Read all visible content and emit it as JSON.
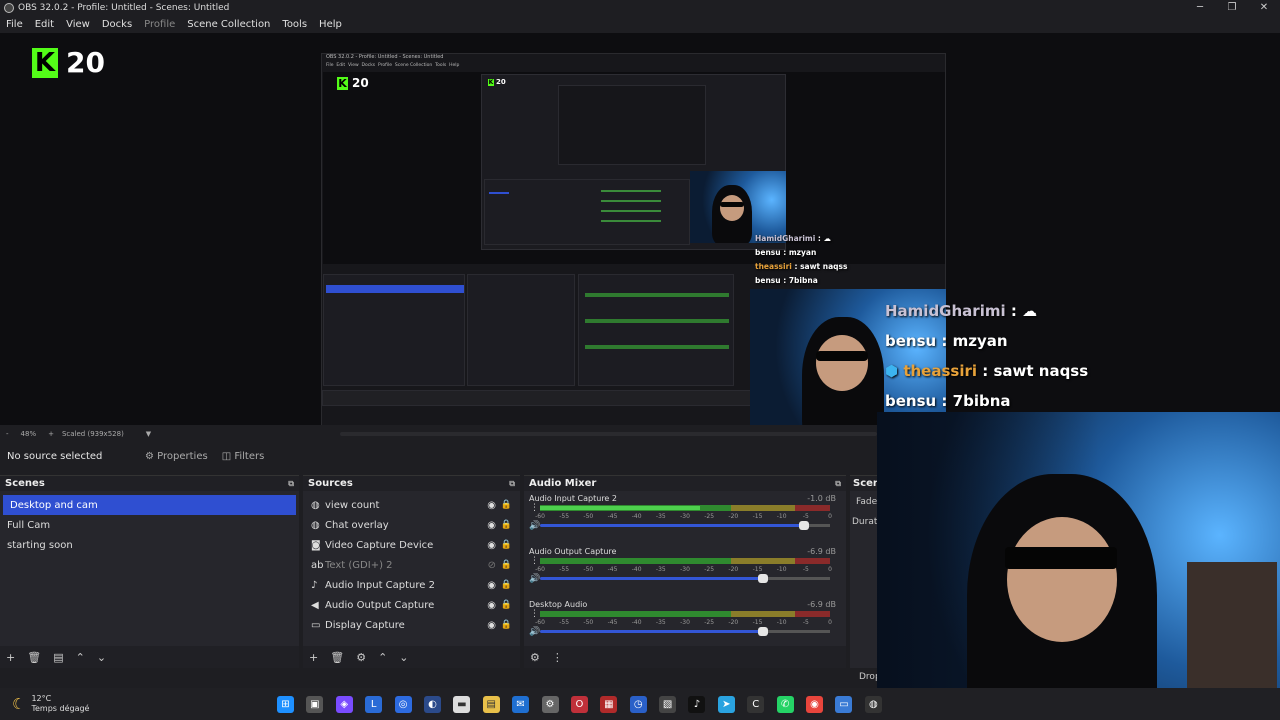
{
  "window": {
    "title": "OBS 32.0.2 - Profile: Untitled - Scenes: Untitled",
    "controls": [
      "─",
      "❐",
      "✕"
    ]
  },
  "menu": {
    "items": [
      "File",
      "Edit",
      "View",
      "Docks",
      "Profile",
      "Scene Collection",
      "Tools",
      "Help"
    ]
  },
  "overlay": {
    "logo_number": "20",
    "logo_letter": "K",
    "brand_color": "#53fc18"
  },
  "chat": [
    {
      "user": "HamidGharimi",
      "sep": " : ",
      "message": "☁"
    },
    {
      "user": "bensu",
      "sep": " : ",
      "message": "mzyan"
    },
    {
      "user": "theassiri",
      "sep": " : ",
      "message": "sawt naqss"
    },
    {
      "user": "bensu",
      "sep": " : ",
      "message": "7bibna"
    }
  ],
  "zoom": {
    "minus": "-",
    "percent": "48%",
    "plus": "+",
    "scaled": "Scaled (939x528)"
  },
  "toolbar": {
    "no_source": "No source selected",
    "properties": "Properties",
    "filters": "Filters"
  },
  "scenes": {
    "header": "Scenes",
    "items": [
      "Desktop and cam",
      "Full Cam",
      "starting soon"
    ],
    "active_index": 0
  },
  "sources": {
    "header": "Sources",
    "items": [
      {
        "label": "view count",
        "icon": "globe-icon"
      },
      {
        "label": "Chat overlay",
        "icon": "globe-icon"
      },
      {
        "label": "Video Capture Device",
        "icon": "camera-icon"
      },
      {
        "label": "Text (GDI+) 2",
        "icon": "text-icon"
      },
      {
        "label": "Audio Input Capture 2",
        "icon": "microphone-icon"
      },
      {
        "label": "Audio Output Capture",
        "icon": "speaker-icon"
      },
      {
        "label": "Display Capture",
        "icon": "monitor-icon"
      }
    ]
  },
  "mixer": {
    "header": "Audio Mixer",
    "ticks": [
      "-60",
      "-55",
      "-50",
      "-45",
      "-40",
      "-35",
      "-30",
      "-25",
      "-20",
      "-15",
      "-10",
      "-5",
      "0"
    ],
    "channels": [
      {
        "name": "Audio Input Capture 2",
        "db": "-1.0 dB",
        "level": 0.55,
        "volume": 0.91
      },
      {
        "name": "Audio Output Capture",
        "db": "-6.9 dB",
        "level": 0.0,
        "volume": 0.77
      },
      {
        "name": "Desktop Audio",
        "db": "-6.9 dB",
        "level": 0.0,
        "volume": 0.77
      }
    ]
  },
  "transitions": {
    "header": "Scene",
    "fade": "Fade",
    "duration": "Durati",
    "drop": "Drop"
  },
  "weather": {
    "temp": "12°C",
    "desc": "Temps dégagé"
  },
  "colors": {
    "accent": "#2f4fd1",
    "panel": "#26262c",
    "background": "#1e1e22"
  }
}
